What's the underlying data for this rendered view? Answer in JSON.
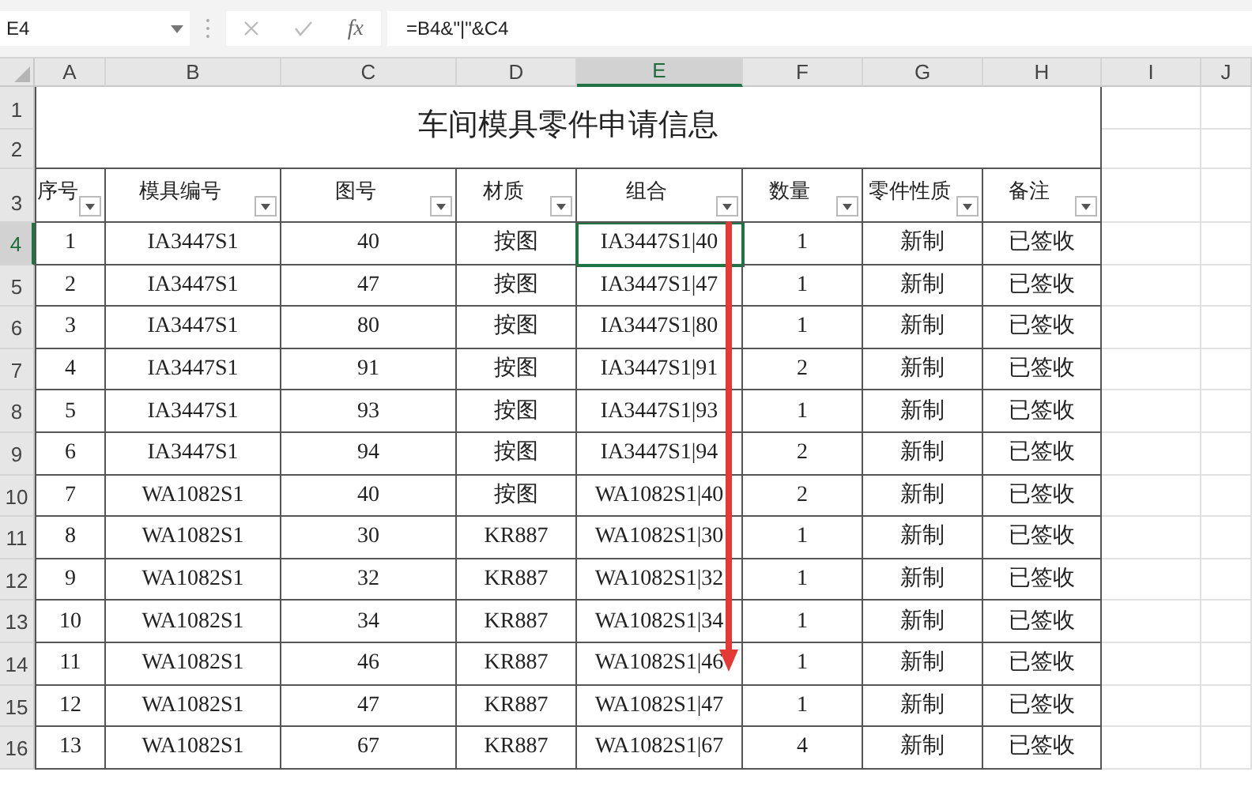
{
  "name_box": "E4",
  "formula_bar": {
    "function_label": "fx",
    "formula": "=B4&\"|\"&C4"
  },
  "column_headers": [
    {
      "label": "A",
      "selected": false
    },
    {
      "label": "B",
      "selected": false
    },
    {
      "label": "C",
      "selected": false
    },
    {
      "label": "D",
      "selected": false
    },
    {
      "label": "E",
      "selected": true
    },
    {
      "label": "F",
      "selected": false
    },
    {
      "label": "G",
      "selected": false
    },
    {
      "label": "H",
      "selected": false
    },
    {
      "label": "I",
      "selected": false
    },
    {
      "label": "J",
      "selected": false
    }
  ],
  "title_row_numbers": [
    "1",
    "2"
  ],
  "title": "车间模具零件申请信息",
  "header_row": {
    "row_number": "3",
    "columns": [
      {
        "label": "序号",
        "filter": true
      },
      {
        "label": "模具编号",
        "filter": true
      },
      {
        "label": "图号",
        "filter": true
      },
      {
        "label": "材质",
        "filter": true
      },
      {
        "label": "组合",
        "filter": true
      },
      {
        "label": "数量",
        "filter": true
      },
      {
        "label": "零件性质",
        "filter": true
      },
      {
        "label": "备注",
        "filter": true
      }
    ]
  },
  "rows": [
    {
      "row_number": "4",
      "selected": true,
      "cells": [
        "1",
        "IA3447S1",
        "40",
        "按图",
        "IA3447S1|40",
        "1",
        "新制",
        "已签收"
      ]
    },
    {
      "row_number": "5",
      "selected": false,
      "cells": [
        "2",
        "IA3447S1",
        "47",
        "按图",
        "IA3447S1|47",
        "1",
        "新制",
        "已签收"
      ]
    },
    {
      "row_number": "6",
      "selected": false,
      "cells": [
        "3",
        "IA3447S1",
        "80",
        "按图",
        "IA3447S1|80",
        "1",
        "新制",
        "已签收"
      ]
    },
    {
      "row_number": "7",
      "selected": false,
      "cells": [
        "4",
        "IA3447S1",
        "91",
        "按图",
        "IA3447S1|91",
        "2",
        "新制",
        "已签收"
      ]
    },
    {
      "row_number": "8",
      "selected": false,
      "cells": [
        "5",
        "IA3447S1",
        "93",
        "按图",
        "IA3447S1|93",
        "1",
        "新制",
        "已签收"
      ]
    },
    {
      "row_number": "9",
      "selected": false,
      "cells": [
        "6",
        "IA3447S1",
        "94",
        "按图",
        "IA3447S1|94",
        "2",
        "新制",
        "已签收"
      ]
    },
    {
      "row_number": "10",
      "selected": false,
      "cells": [
        "7",
        "WA1082S1",
        "40",
        "按图",
        "WA1082S1|40",
        "2",
        "新制",
        "已签收"
      ]
    },
    {
      "row_number": "11",
      "selected": false,
      "cells": [
        "8",
        "WA1082S1",
        "30",
        "KR887",
        "WA1082S1|30",
        "1",
        "新制",
        "已签收"
      ]
    },
    {
      "row_number": "12",
      "selected": false,
      "cells": [
        "9",
        "WA1082S1",
        "32",
        "KR887",
        "WA1082S1|32",
        "1",
        "新制",
        "已签收"
      ]
    },
    {
      "row_number": "13",
      "selected": false,
      "cells": [
        "10",
        "WA1082S1",
        "34",
        "KR887",
        "WA1082S1|34",
        "1",
        "新制",
        "已签收"
      ]
    },
    {
      "row_number": "14",
      "selected": false,
      "cells": [
        "11",
        "WA1082S1",
        "46",
        "KR887",
        "WA1082S1|46",
        "1",
        "新制",
        "已签收"
      ]
    },
    {
      "row_number": "15",
      "selected": false,
      "cells": [
        "12",
        "WA1082S1",
        "47",
        "KR887",
        "WA1082S1|47",
        "1",
        "新制",
        "已签收"
      ]
    },
    {
      "row_number": "16",
      "selected": false,
      "cells": [
        "13",
        "WA1082S1",
        "67",
        "KR887",
        "WA1082S1|67",
        "4",
        "新制",
        "已签收"
      ]
    }
  ]
}
